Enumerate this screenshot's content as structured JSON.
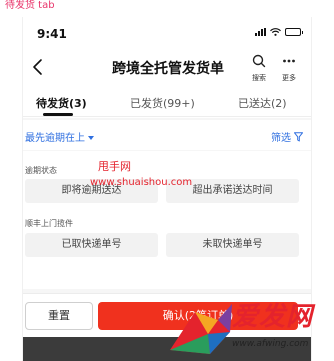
{
  "annotation": "待发货 tab",
  "status_bar": {
    "time": "9:41"
  },
  "nav": {
    "title": "跨境全托管发货单",
    "search_label": "搜索",
    "more_label": "更多"
  },
  "tabs": [
    {
      "label": "待发货(3)",
      "active": true
    },
    {
      "label": "已发货(99+)",
      "active": false
    },
    {
      "label": "已送达(2)",
      "active": false
    }
  ],
  "sort": {
    "label": "最先逾期在上"
  },
  "filter": {
    "label": "筛选"
  },
  "filter_groups": [
    {
      "title": "逾期状态",
      "options": [
        "即将逾期送达",
        "超出承诺送达时间"
      ]
    },
    {
      "title": "顺丰上门揽件",
      "options": [
        "已取快递单号",
        "未取快递单号"
      ]
    }
  ],
  "footer": {
    "reset_label": "重置",
    "confirm_label": "确认(2笔订单)"
  },
  "watermark": {
    "line1": "甩手网",
    "line2": "www.shuaishou.com"
  },
  "logo": {
    "text": "爱发网",
    "url": "www.afwing.com"
  },
  "colors": {
    "accent_blue": "#2f6fe0",
    "confirm_red": "#f0311e",
    "watermark_red": "#e4232d"
  }
}
